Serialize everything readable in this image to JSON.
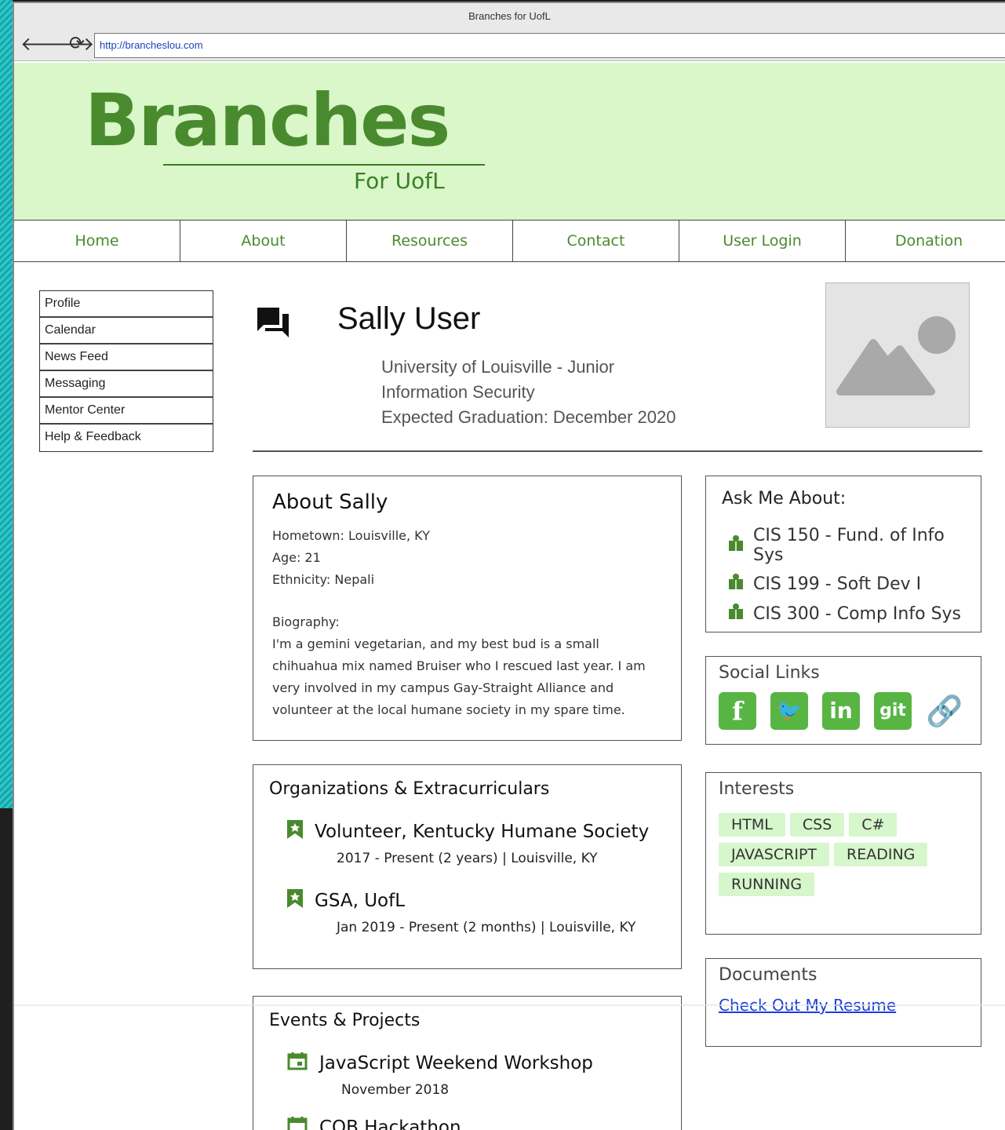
{
  "browser": {
    "window_title": "Branches for UofL",
    "url": "http://brancheslou.com",
    "back_label": "🡐",
    "forward_label": "🡒",
    "reload_label": "⟳"
  },
  "brand": {
    "logo_text": "Branches",
    "tagline": "For UofL",
    "accent": "#4a8a2e",
    "hero_bg": "#d9f7c8"
  },
  "main_nav": [
    "Home",
    "About",
    "Resources",
    "Contact",
    "User Login",
    "Donation"
  ],
  "side_menu": [
    "Profile",
    "Calendar",
    "News Feed",
    "Messaging",
    "Mentor Center",
    "Help & Feedback"
  ],
  "profile": {
    "name": "Sally User",
    "school_line": "University of Louisville - Junior",
    "major_line": "Information Security",
    "graduation_line": "Expected Graduation:  December 2020"
  },
  "about": {
    "title": "About Sally",
    "hometown": "Hometown:  Louisville, KY",
    "age": "Age:  21",
    "ethnicity": "Ethnicity:  Nepali",
    "bio_label": "Biography:",
    "bio_text": "I'm a gemini vegetarian, and my best bud is a small chihuahua mix  named Bruiser who I rescued last year. I am very involved in my campus Gay-Straight Alliance and volunteer at the local humane society in my spare time."
  },
  "ask_me": {
    "title": "Ask Me About:",
    "items": [
      "CIS 150 - Fund. of Info Sys",
      "CIS 199 - Soft Dev I",
      "CIS 300 - Comp Info Sys"
    ]
  },
  "social": {
    "title": "Social Links",
    "icons": [
      "facebook-icon",
      "twitter-icon",
      "linkedin-icon",
      "git-icon",
      "link-icon"
    ],
    "labels": {
      "facebook": "f",
      "twitter": "🐦",
      "linkedin": "in",
      "git": "git",
      "link": "🔗"
    }
  },
  "interests": {
    "title": "Interests",
    "tags": [
      "HTML",
      "CSS",
      "C#",
      "JAVASCRIPT",
      "READING",
      "RUNNING"
    ]
  },
  "documents": {
    "title": "Documents",
    "link": "Check Out My Resume"
  },
  "orgs": {
    "title": "Organizations & Extracurriculars",
    "items": [
      {
        "name": "Volunteer, Kentucky Humane Society",
        "detail": "2017 - Present (2 years)  |  Louisville, KY"
      },
      {
        "name": "GSA, UofL",
        "detail": "Jan 2019 - Present (2 months)  |  Louisville, KY"
      }
    ]
  },
  "events": {
    "title": "Events & Projects",
    "items": [
      {
        "name": "JavaScript Weekend Workshop",
        "detail": "November 2018"
      },
      {
        "name": "COB Hackathon",
        "detail": ""
      }
    ]
  }
}
